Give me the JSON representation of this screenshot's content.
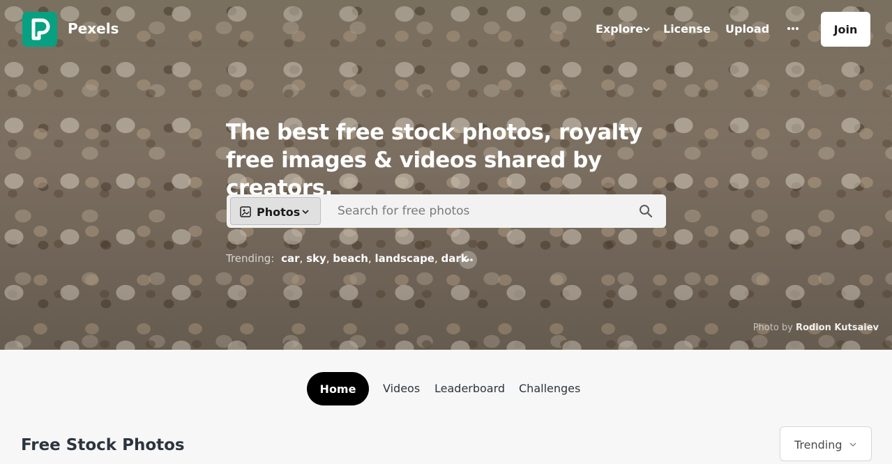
{
  "brand": {
    "name": "Pexels",
    "accent": "#07a081"
  },
  "nav": {
    "explore": "Explore",
    "license": "License",
    "upload": "Upload",
    "more_icon": "ellipsis-icon",
    "join": "Join"
  },
  "hero": {
    "headline": "The best free stock photos, royalty free images & videos shared by creators.",
    "search": {
      "type_label": "Photos",
      "type_icon": "image-icon",
      "placeholder": "Search for free photos",
      "search_icon": "search-icon"
    },
    "trending": {
      "label": "Trending:",
      "tags": [
        "car",
        "sky",
        "beach",
        "landscape",
        "dark"
      ],
      "more_icon": "ellipsis-icon"
    },
    "credit": {
      "prefix": "Photo by",
      "name": "Rodion Kutsaiev"
    }
  },
  "tabs": [
    {
      "label": "Home",
      "active": true
    },
    {
      "label": "Videos",
      "active": false
    },
    {
      "label": "Leaderboard",
      "active": false
    },
    {
      "label": "Challenges",
      "active": false
    }
  ],
  "section": {
    "title": "Free Stock Photos",
    "sort": "Trending"
  }
}
